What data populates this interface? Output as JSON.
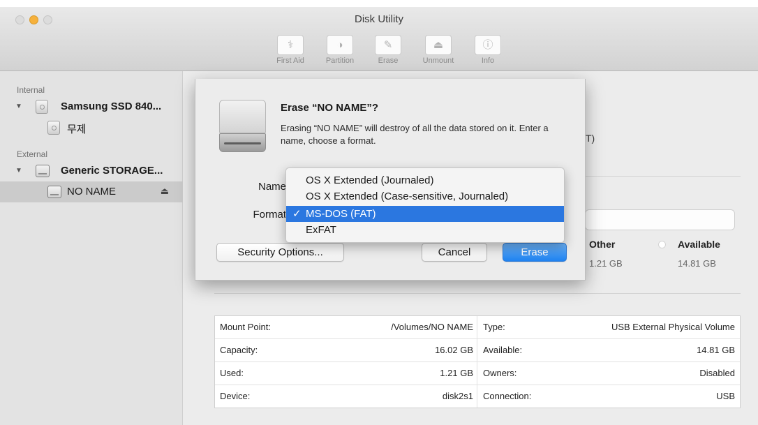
{
  "window": {
    "title": "Disk Utility"
  },
  "toolbar": {
    "items": [
      {
        "label": "First Aid",
        "icon": "stethoscope-icon",
        "glyph": "⚕"
      },
      {
        "label": "Partition",
        "icon": "partition-icon",
        "glyph": "◑"
      },
      {
        "label": "Erase",
        "icon": "erase-icon",
        "glyph": "✎"
      },
      {
        "label": "Unmount",
        "icon": "unmount-icon",
        "glyph": "⏏"
      },
      {
        "label": "Info",
        "icon": "info-icon",
        "glyph": "ⓘ"
      }
    ]
  },
  "sidebar": {
    "internal_label": "Internal",
    "external_label": "External",
    "internal_disk": "Samsung SSD 840...",
    "internal_volume": "무제",
    "external_disk": "Generic STORAGE...",
    "external_volume": "NO NAME",
    "eject_glyph": "⏏",
    "disclosure_glyph": "▼"
  },
  "main": {
    "partial_text": "T)",
    "usage": {
      "other_label": "Other",
      "other_value": "1.21 GB",
      "available_label": "Available",
      "available_value": "14.81 GB"
    },
    "info_rows": [
      {
        "key": "Mount Point:",
        "value": "/Volumes/NO NAME",
        "key2": "Type:",
        "value2": "USB External Physical Volume"
      },
      {
        "key": "Capacity:",
        "value": "16.02 GB",
        "key2": "Available:",
        "value2": "14.81 GB"
      },
      {
        "key": "Used:",
        "value": "1.21 GB",
        "key2": "Owners:",
        "value2": "Disabled"
      },
      {
        "key": "Device:",
        "value": "disk2s1",
        "key2": "Connection:",
        "value2": "USB"
      }
    ]
  },
  "dialog": {
    "title": "Erase “NO NAME”?",
    "message": "Erasing “NO NAME” will destroy of all the data stored on it. Enter a name, choose a format.",
    "name_label": "Name",
    "format_label": "Format",
    "security_button": "Security Options...",
    "cancel_button": "Cancel",
    "erase_button": "Erase"
  },
  "format_menu": {
    "checkmark": "✓",
    "selected_index": 2,
    "options": [
      "OS X Extended (Journaled)",
      "OS X Extended (Case-sensitive, Journaled)",
      "MS-DOS (FAT)",
      "ExFAT"
    ]
  },
  "colors": {
    "accent": "#2b77e0",
    "erase_button": "#1e82f0",
    "sidebar_selection": "#cbcbcb"
  }
}
